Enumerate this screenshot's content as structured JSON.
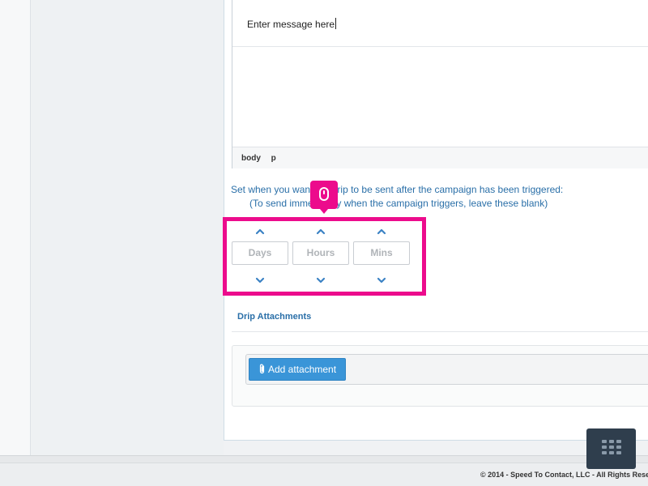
{
  "editor": {
    "message_text": "Enter message here",
    "status_path": [
      "body",
      "p"
    ]
  },
  "instructions": {
    "line1": "Set when you want the drip to be sent after the campaign has been triggered:",
    "line2": "(To send immediately when the campaign triggers, leave these blank)"
  },
  "time_picker": {
    "fields": [
      {
        "placeholder": "Days"
      },
      {
        "placeholder": "Hours"
      },
      {
        "placeholder": "Mins"
      }
    ]
  },
  "drip": {
    "title": "Drip Attachments",
    "add_button_label": "Add attachment"
  },
  "footer": {
    "text": "© 2014 - Speed To Contact, LLC - All Rights Rese"
  },
  "colors": {
    "highlight": "#ec0b8c",
    "link_blue": "#2a6fa8",
    "button_blue": "#3a95d8",
    "dark_button": "#2f3e4d"
  },
  "icons": {
    "tooltip": "mouse-icon",
    "attachment": "paperclip-icon",
    "grid": "grid-icon"
  }
}
